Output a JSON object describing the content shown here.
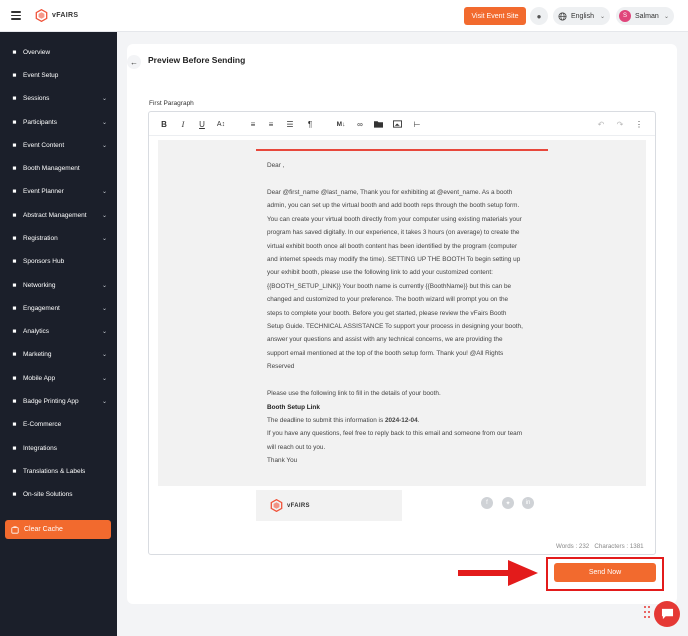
{
  "header": {
    "brand": "vFAIRS",
    "visit_event_site": "Visit Event Site",
    "language": "English",
    "user_initial": "S",
    "user_name": "Salman"
  },
  "sidebar": {
    "items": [
      {
        "label": "Overview",
        "icon": "gauge-icon",
        "chevron": false
      },
      {
        "label": "Event Setup",
        "icon": "gear-icon",
        "chevron": false
      },
      {
        "label": "Sessions",
        "icon": "grid-icon",
        "chevron": true
      },
      {
        "label": "Participants",
        "icon": "users-icon",
        "chevron": true
      },
      {
        "label": "Event Content",
        "icon": "document-icon",
        "chevron": true
      },
      {
        "label": "Booth Management",
        "icon": "booth-icon",
        "chevron": false
      },
      {
        "label": "Event Planner",
        "icon": "planner-icon",
        "chevron": true
      },
      {
        "label": "Abstract Management",
        "icon": "abstract-icon",
        "chevron": true
      },
      {
        "label": "Registration",
        "icon": "user-plus-icon",
        "chevron": true
      },
      {
        "label": "Sponsors Hub",
        "icon": "sponsors-icon",
        "chevron": false
      },
      {
        "label": "Networking",
        "icon": "share-icon",
        "chevron": true
      },
      {
        "label": "Engagement",
        "icon": "flag-icon",
        "chevron": true
      },
      {
        "label": "Analytics",
        "icon": "bar-chart-icon",
        "chevron": true
      },
      {
        "label": "Marketing",
        "icon": "send-icon",
        "chevron": true
      },
      {
        "label": "Mobile App",
        "icon": "mobile-icon",
        "chevron": true
      },
      {
        "label": "Badge Printing App",
        "icon": "badge-icon",
        "chevron": true
      },
      {
        "label": "E-Commerce",
        "icon": "cart-icon",
        "chevron": false
      },
      {
        "label": "Integrations",
        "icon": "plug-icon",
        "chevron": false
      },
      {
        "label": "Translations & Labels",
        "icon": "translate-icon",
        "chevron": false
      },
      {
        "label": "On-site Solutions",
        "icon": "sun-icon",
        "chevron": false
      }
    ],
    "clear_cache": "Clear Cache"
  },
  "page": {
    "title": "Preview Before Sending",
    "field_label": "First Paragraph"
  },
  "email": {
    "greeting": "Dear ,",
    "body_lines": [
      "Dear @first_name @last_name, Thank you for exhibiting at @event_name. As a booth",
      "admin, you can set up the virtual booth and add booth reps through the booth setup form.",
      "You can create your virtual booth directly from your computer using existing materials your",
      "program has saved digitally. In our experience, it takes 3 hours (on average) to create the",
      "virtual exhibit booth once all booth content has been identified by the program (computer",
      "and internet speeds may modify the time). SETTING UP THE BOOTH To begin setting up",
      "your exhibit booth, please use the following link to add your customized content:",
      "{{BOOTH_SETUP_LINK}} Your booth name is currently {{BoothName}} but this can be",
      "changed and customized to your preference. The booth wizard will prompt you on the",
      "steps to complete your booth. Before you get started, please review the vFairs Booth",
      "Setup Guide. TECHNICAL ASSISTANCE To support your process in designing your booth,",
      "answer your questions and assist with any technical concerns, we are providing the",
      "support email mentioned at the top of the booth setup form. Thank you! @All Rights",
      "Reserved"
    ],
    "fill_details": "Please use the following link to fill in the details of your booth.",
    "setup_link": "Booth Setup Link",
    "deadline_prefix": "The deadline to submit this information is ",
    "deadline_date": "2024-12-04",
    "deadline_suffix": ".",
    "questions_line1": "If you have any questions, feel free to reply back to this email and someone from our team",
    "questions_line2": "will reach out to you.",
    "thanks": "Thank You",
    "footer_brand": "vFAIRS"
  },
  "editor": {
    "words": "Words : 232",
    "characters": "Characters : 1381"
  },
  "actions": {
    "send_now": "Send Now"
  },
  "colors": {
    "accent": "#f26a2e",
    "sidebar_bg": "#1b1f2a",
    "highlight": "#e31b1b"
  }
}
